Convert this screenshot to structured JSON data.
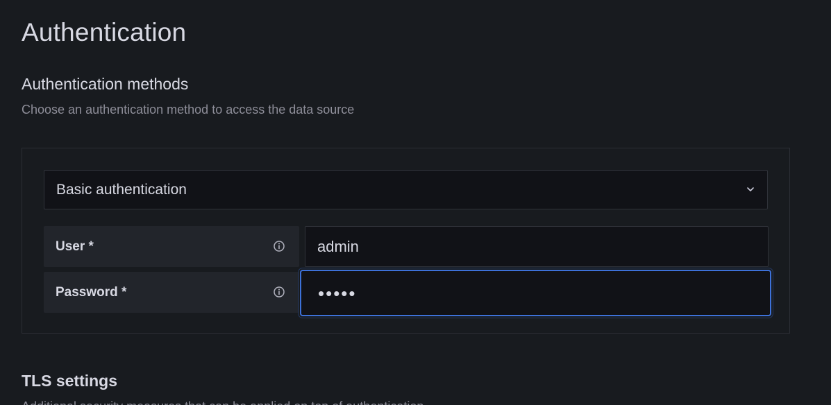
{
  "page": {
    "title": "Authentication"
  },
  "auth_methods": {
    "title": "Authentication methods",
    "description": "Choose an authentication method to access the data source",
    "select": {
      "value": "Basic authentication",
      "icon": "chevron-down-icon"
    },
    "fields": [
      {
        "label": "User *",
        "value": "admin",
        "icon": "info-icon"
      },
      {
        "label": "Password *",
        "value": "•••••",
        "icon": "info-icon",
        "focused": true
      }
    ]
  },
  "tls": {
    "title": "TLS settings",
    "description": "Additional security measures that can be applied on top of authentication"
  },
  "colors": {
    "background": "#181b1f",
    "input_background": "#111217",
    "label_background": "#22252b",
    "focus_border": "#3d71d9",
    "text_primary": "#d8d9e3",
    "text_secondary": "#8e8e99"
  }
}
